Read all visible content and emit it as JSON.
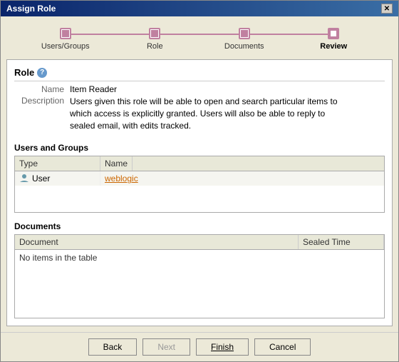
{
  "window": {
    "title": "Assign Role",
    "close_button": "✕"
  },
  "wizard": {
    "steps": [
      {
        "id": "users-groups",
        "label": "Users/Groups",
        "active": false
      },
      {
        "id": "role",
        "label": "Role",
        "active": false
      },
      {
        "id": "documents",
        "label": "Documents",
        "active": false
      },
      {
        "id": "review",
        "label": "Review",
        "active": true
      }
    ]
  },
  "role_section": {
    "title": "Role",
    "help_icon": "?",
    "name_label": "Name",
    "name_value": "Item Reader",
    "description_label": "Description",
    "description_value": "Users given this role will be able to open and search particular items to which access is explicitly granted. Users will also be able to reply to sealed email, with edits tracked."
  },
  "users_groups": {
    "title": "Users and Groups",
    "columns": [
      "Type",
      "Name"
    ],
    "rows": [
      {
        "type": "User",
        "name": "weblogic",
        "has_icon": true
      }
    ]
  },
  "documents": {
    "title": "Documents",
    "columns": [
      "Document",
      "Sealed Time"
    ],
    "empty_message": "No items in the table"
  },
  "buttons": {
    "back": "Back",
    "next": "Next",
    "finish": "Finish",
    "cancel": "Cancel"
  }
}
